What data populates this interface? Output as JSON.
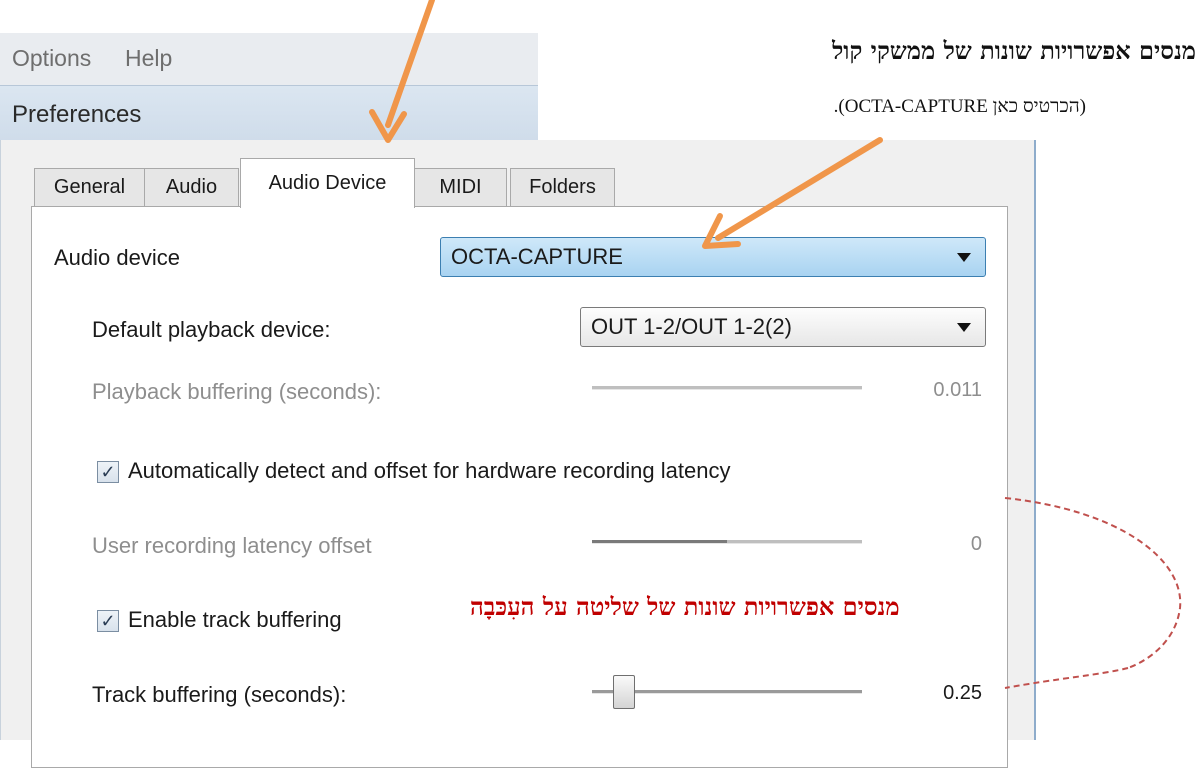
{
  "menubar": {
    "items": [
      "Options",
      "Help"
    ]
  },
  "window": {
    "title": "Preferences"
  },
  "tabs": [
    {
      "label": "General",
      "active": false
    },
    {
      "label": "Audio",
      "active": false
    },
    {
      "label": "Audio Device",
      "active": true
    },
    {
      "label": "MIDI",
      "active": false
    },
    {
      "label": "Folders",
      "active": false
    }
  ],
  "audio_device": {
    "label": "Audio device",
    "selected": "OCTA-CAPTURE"
  },
  "playback_device": {
    "label": "Default playback device:",
    "selected": "OUT 1-2/OUT 1-2(2)"
  },
  "playback_buffering": {
    "label": "Playback buffering (seconds):",
    "value": "0.011"
  },
  "auto_detect": {
    "label": "Automatically detect and offset for hardware recording latency",
    "checked": true
  },
  "user_latency": {
    "label": "User recording latency offset",
    "value": "0",
    "fill_fraction": 0.5
  },
  "enable_track_buffering": {
    "label": "Enable track buffering",
    "checked": true
  },
  "track_buffering": {
    "label": "Track buffering (seconds):",
    "value": "0.25",
    "position_fraction": 0.12
  },
  "annotations": {
    "heading": "מנסים אפשרויות שונות של ממשקי קול",
    "subtext": "(הכרטיס כאן OCTA-CAPTURE).",
    "latency_note": "מנסים אפשרויות שונות של שליטה על העִכּבָה"
  },
  "colors": {
    "arrow": "#f0964a",
    "annotation_red": "#c00000",
    "dashed_callout": "#c0504d",
    "focused_select": "#a9d3f1"
  }
}
